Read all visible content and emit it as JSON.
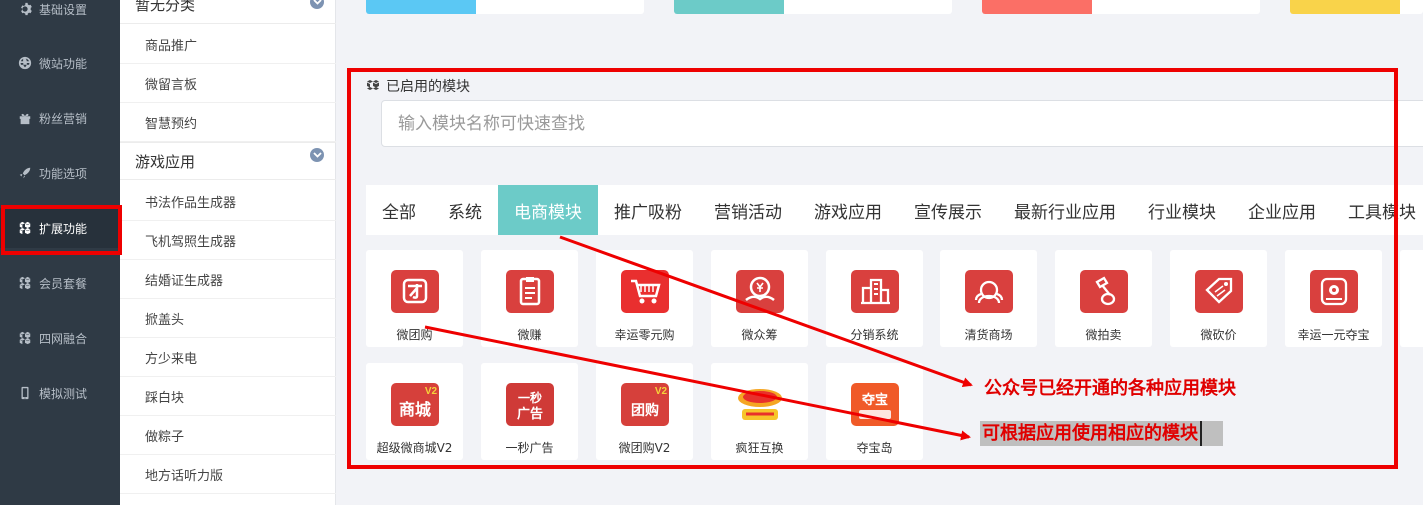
{
  "colors": {
    "nav_bg": "#2f3a45",
    "nav_active_bg": "#27313b",
    "tab_active": "#6ccbc8",
    "module_red": "#d9403e",
    "annotation_red": "#ee0000",
    "stat_blue": "#5bc8f4",
    "stat_teal": "#6ccbc8",
    "stat_coral": "#fb6f66",
    "stat_yellow": "#f9d34a"
  },
  "nav": {
    "items": [
      {
        "label": "基础设置",
        "icon": "gear-icon"
      },
      {
        "label": "微站功能",
        "icon": "globe-icon"
      },
      {
        "label": "粉丝营销",
        "icon": "gift-icon"
      },
      {
        "label": "功能选项",
        "icon": "rocket-icon"
      },
      {
        "label": "扩展功能",
        "icon": "cubes-icon",
        "active": true
      },
      {
        "label": "会员套餐",
        "icon": "cubes-icon"
      },
      {
        "label": "四网融合",
        "icon": "cubes-icon"
      },
      {
        "label": "模拟测试",
        "icon": "mobile-icon"
      }
    ]
  },
  "submenu": {
    "group_top": "暂无分类",
    "items_top": [
      "商品推广",
      "微留言板",
      "智慧预约"
    ],
    "group_games": "游戏应用",
    "items_games": [
      "书法作品生成器",
      "飞机驾照生成器",
      "结婚证生成器",
      "掀盖头",
      "方少来电",
      "踩白块",
      "做粽子",
      "地方话听力版"
    ]
  },
  "panel": {
    "title": "已启用的模块",
    "search_placeholder": "输入模块名称可快速查找",
    "tabs": [
      "全部",
      "系统",
      "电商模块",
      "推广吸粉",
      "营销活动",
      "游戏应用",
      "宣传展示",
      "最新行业应用",
      "行业模块",
      "企业应用",
      "工具模块"
    ],
    "active_tab": "电商模块",
    "modules_row1": [
      {
        "label": "微团购",
        "icon": "group-buy-icon"
      },
      {
        "label": "微赚",
        "icon": "clipboard-icon"
      },
      {
        "label": "幸运零元购",
        "icon": "shopping-cart-icon"
      },
      {
        "label": "微众筹",
        "icon": "crowdfunding-icon"
      },
      {
        "label": "分销系统",
        "icon": "buildings-icon"
      },
      {
        "label": "清货商场",
        "icon": "store-icon"
      },
      {
        "label": "微拍卖",
        "icon": "auction-icon"
      },
      {
        "label": "微砍价",
        "icon": "tag-icon"
      },
      {
        "label": "幸运一元夺宝",
        "icon": "coin-icon"
      }
    ],
    "modules_row2": [
      {
        "label": "超级微商城V2",
        "icon": "mall-v2-icon",
        "tile_text": "商城",
        "badge": "V2"
      },
      {
        "label": "一秒广告",
        "icon": "ad-icon",
        "tile_text_1": "一秒",
        "tile_text_2": "广告"
      },
      {
        "label": "微团购V2",
        "icon": "group-buy-v2-icon",
        "tile_text": "团购",
        "badge": "V2"
      },
      {
        "label": "疯狂互换",
        "icon": "swap-icon"
      },
      {
        "label": "夺宝岛",
        "icon": "treasure-icon",
        "tile_text": "夺宝"
      }
    ]
  },
  "annotations": {
    "note_1": "公众号已经开通的各种应用模块",
    "note_2": "可根据应用使用相应的模块"
  }
}
